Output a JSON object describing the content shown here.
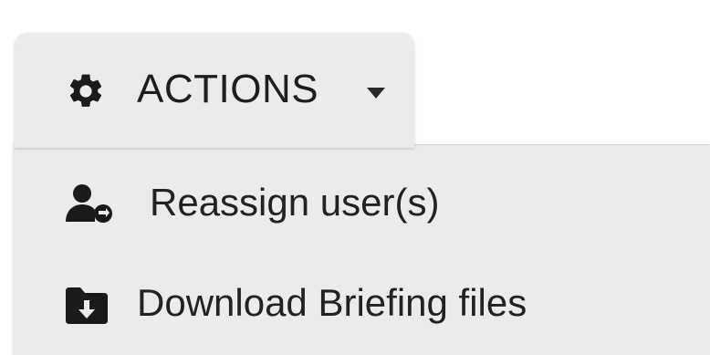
{
  "actions_menu": {
    "button_label": "ACTIONS",
    "button_icon": "gear-icon",
    "caret_icon": "caret-down-icon",
    "items": [
      {
        "label": "Reassign user(s)",
        "icon": "user-reassign-icon"
      },
      {
        "label": "Download Briefing files",
        "icon": "folder-download-icon"
      }
    ]
  },
  "colors": {
    "button_bg": "#ebebeb",
    "menu_bg": "#ebebeb",
    "text": "#1e1e1e",
    "icon": "#1a1a1a"
  }
}
